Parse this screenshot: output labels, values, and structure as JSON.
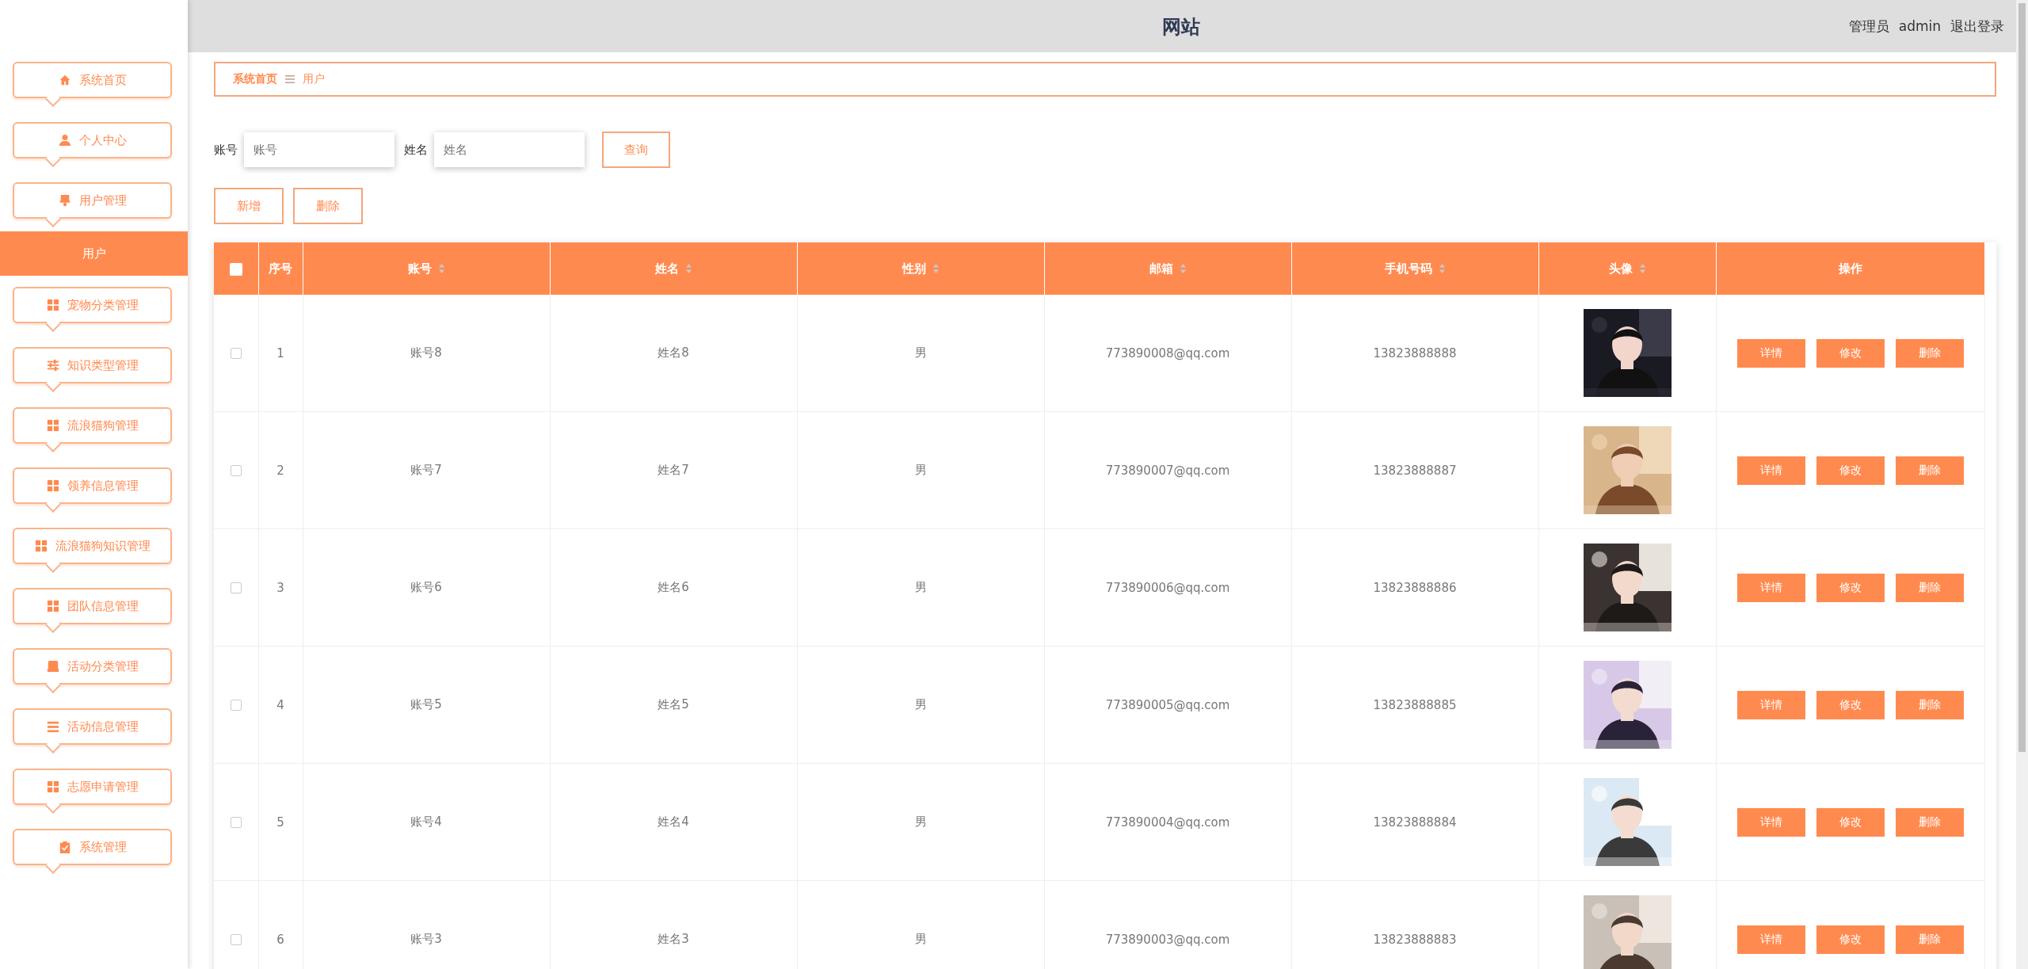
{
  "header": {
    "title": "网站",
    "role": "管理员",
    "username": "admin",
    "logout": "退出登录"
  },
  "sidebar": {
    "items": [
      {
        "label": "系统首页"
      },
      {
        "label": "个人中心"
      },
      {
        "label": "用户管理",
        "children": [
          {
            "label": "用户",
            "selected": true
          }
        ]
      },
      {
        "label": "宠物分类管理"
      },
      {
        "label": "知识类型管理"
      },
      {
        "label": "流浪猫狗管理"
      },
      {
        "label": "领养信息管理"
      },
      {
        "label": "流浪猫狗知识管理"
      },
      {
        "label": "团队信息管理"
      },
      {
        "label": "活动分类管理"
      },
      {
        "label": "活动信息管理"
      },
      {
        "label": "志愿申请管理"
      },
      {
        "label": "系统管理"
      }
    ]
  },
  "breadcrumb": [
    {
      "label": "系统首页",
      "kind": "link"
    },
    {
      "label": "用户",
      "kind": "current"
    }
  ],
  "search": {
    "fields": [
      {
        "label": "账号",
        "placeholder": "账号"
      },
      {
        "label": "姓名",
        "placeholder": "姓名"
      }
    ],
    "button": "查询"
  },
  "actions": [
    "新增",
    "删除"
  ],
  "table": {
    "select_all": {
      "checked": false
    },
    "columns": [
      {
        "label": "序号",
        "sortable": false
      },
      {
        "label": "账号",
        "sortable": true
      },
      {
        "label": "姓名",
        "sortable": true
      },
      {
        "label": "性别",
        "sortable": true
      },
      {
        "label": "邮箱",
        "sortable": true
      },
      {
        "label": "手机号码",
        "sortable": true
      },
      {
        "label": "头像",
        "sortable": true
      },
      {
        "label": "操作",
        "sortable": false
      }
    ],
    "rows": [
      {
        "checked": false,
        "cells": [
          "1",
          "账号8",
          "姓名8",
          "男",
          "773890008@qq.com",
          "13823888888"
        ],
        "buttons": [
          "详情",
          "修改",
          "删除"
        ]
      },
      {
        "checked": false,
        "cells": [
          "2",
          "账号7",
          "姓名7",
          "男",
          "773890007@qq.com",
          "13823888887"
        ],
        "buttons": [
          "详情",
          "修改",
          "删除"
        ]
      },
      {
        "checked": false,
        "cells": [
          "3",
          "账号6",
          "姓名6",
          "男",
          "773890006@qq.com",
          "13823888886"
        ],
        "buttons": [
          "详情",
          "修改",
          "删除"
        ]
      },
      {
        "checked": false,
        "cells": [
          "4",
          "账号5",
          "姓名5",
          "男",
          "773890005@qq.com",
          "13823888885"
        ],
        "buttons": [
          "详情",
          "修改",
          "删除"
        ]
      },
      {
        "checked": false,
        "cells": [
          "5",
          "账号4",
          "姓名4",
          "男",
          "773890004@qq.com",
          "13823888884"
        ],
        "buttons": [
          "详情",
          "修改",
          "删除"
        ]
      },
      {
        "checked": false,
        "cells": [
          "6",
          "账号3",
          "姓名3",
          "男",
          "773890003@qq.com",
          "13823888883"
        ],
        "buttons": [
          "详情",
          "修改",
          "删除"
        ]
      }
    ]
  }
}
